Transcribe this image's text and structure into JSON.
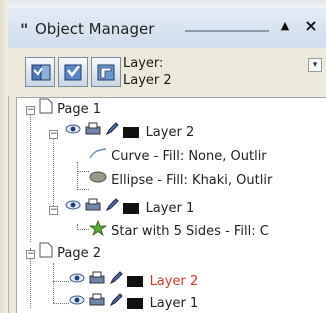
{
  "window": {
    "title": "Object Manager"
  },
  "controls": {
    "collapse_glyph": "▲",
    "close_glyph": "×",
    "grip_glyph": "\""
  },
  "toolbar": {
    "current_layer_label": "Layer:",
    "current_layer_value": "Layer 2",
    "dropdown_glyph": "▾",
    "buttons": [
      "show-object-properties-icon",
      "edit-across-layers-icon",
      "layer-manager-view-icon"
    ]
  },
  "tree": {
    "expanded_glyph": "−",
    "nodes": [
      {
        "label": "Page 1"
      },
      {
        "label": "Layer 2",
        "swatch": "#111111",
        "active": false
      },
      {
        "label": "Curve - Fill: None, Outlir"
      },
      {
        "label": "Ellipse - Fill: Khaki, Outlir"
      },
      {
        "label": "Layer 1",
        "swatch": "#111111"
      },
      {
        "label": "Star with 5 Sides - Fill: C"
      },
      {
        "label": "Page 2"
      },
      {
        "label": "Layer 2",
        "swatch": "#111111",
        "active": true
      },
      {
        "label": "Layer 1",
        "swatch": "#111111"
      }
    ]
  },
  "colors": {
    "active_layer": "#d93a2e",
    "ellipse_fill": "#9c9a86",
    "star_fill": "#5aa832"
  }
}
